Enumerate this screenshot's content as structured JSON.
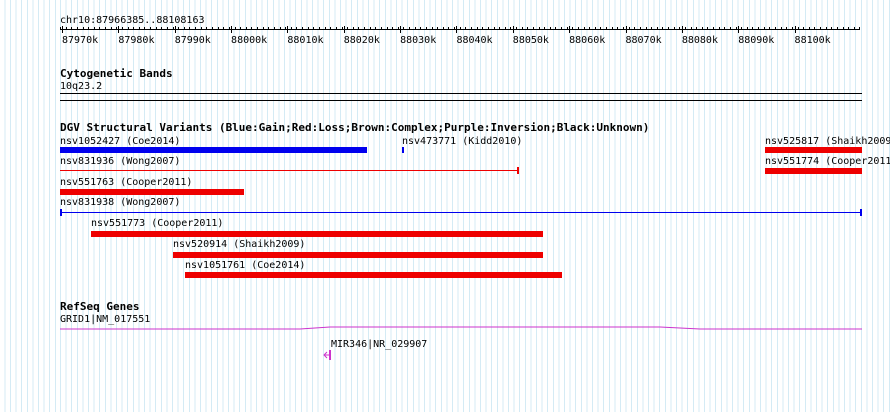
{
  "ruler": {
    "location": "chr10:87966385..88108163",
    "ticks": [
      "87970k",
      "87980k",
      "87990k",
      "88000k",
      "88010k",
      "88020k",
      "88030k",
      "88040k",
      "88050k",
      "88060k",
      "88070k",
      "88080k",
      "88090k",
      "88100k"
    ]
  },
  "cytoband": {
    "title": "Cytogenetic Bands",
    "band": "10q23.2"
  },
  "dgv": {
    "title": "DGV Structural Variants (Blue:Gain;Red:Loss;Brown:Complex;Purple:Inversion;Black:Unknown)",
    "variants": [
      {
        "label": "nsv1052427 (Coe2014)",
        "color": "#0000ee"
      },
      {
        "label": "nsv473771 (Kidd2010)",
        "color": "#0000ee"
      },
      {
        "label": "nsv525817 (Shaikh2009",
        "color": "#ee0000"
      },
      {
        "label": "nsv831936 (Wong2007)",
        "color": "#ee0000"
      },
      {
        "label": "nsv551774 (Cooper2011",
        "color": "#ee0000"
      },
      {
        "label": "nsv551763 (Cooper2011)",
        "color": "#ee0000"
      },
      {
        "label": "nsv831938 (Wong2007)",
        "color": "#0000ee"
      },
      {
        "label": "nsv551773 (Cooper2011)",
        "color": "#ee0000"
      },
      {
        "label": "nsv520914 (Shaikh2009)",
        "color": "#ee0000"
      },
      {
        "label": "nsv1051761 (Coe2014)",
        "color": "#ee0000"
      }
    ]
  },
  "refseq": {
    "title": "RefSeq Genes",
    "genes": [
      {
        "label": "GRID1|NM_017551",
        "color": "#cc33cc"
      },
      {
        "label": "MIR346|NR_029907",
        "color": "#cc33cc"
      }
    ]
  },
  "colors": {
    "gain": "#0000ee",
    "loss": "#ee0000",
    "gene": "#cc33cc",
    "grid": "#d4ebf5"
  }
}
